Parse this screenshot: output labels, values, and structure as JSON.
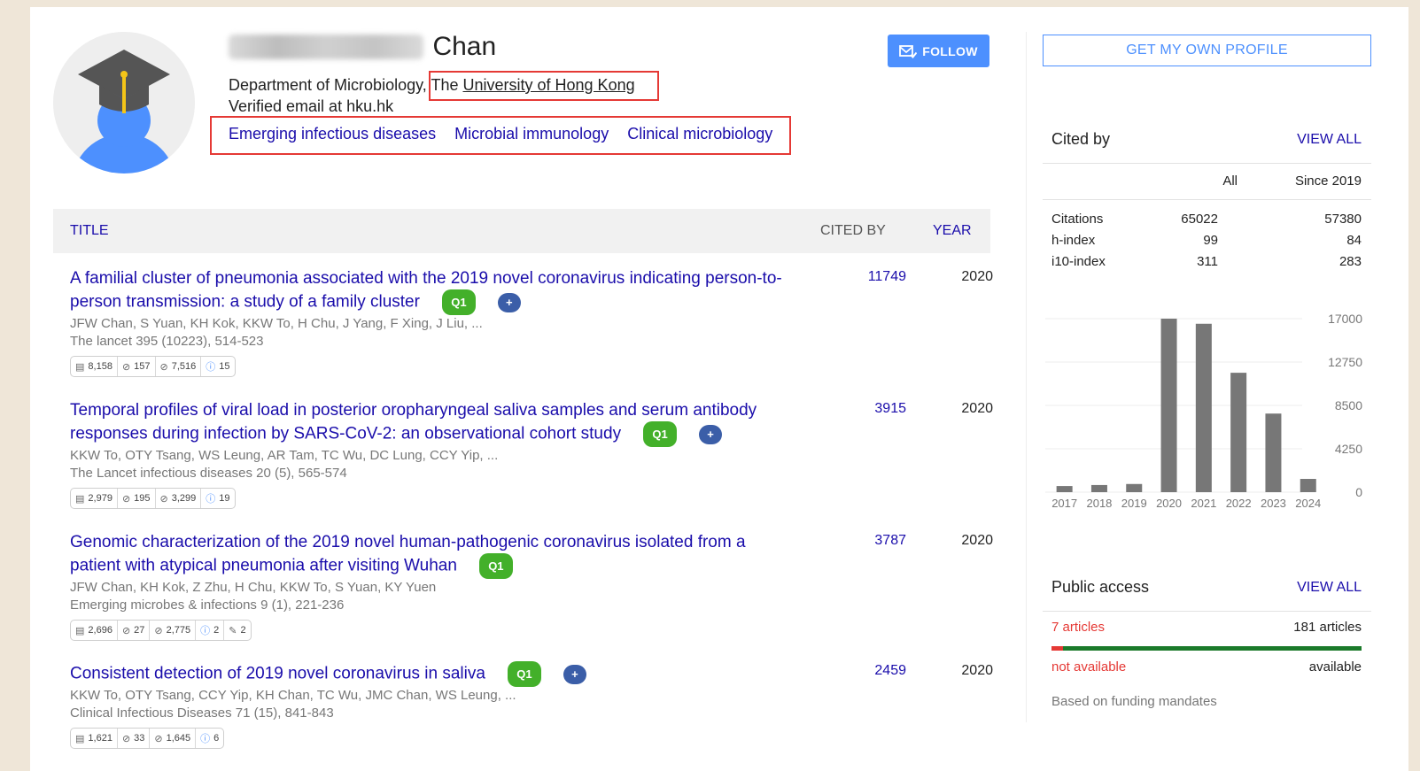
{
  "profile": {
    "name_visible": "Chan",
    "affiliation_prefix": "Department of Microbiology,",
    "affiliation_the": "The",
    "affiliation_link": "University of Hong Kong",
    "email": "Verified email at hku.hk",
    "interests": [
      "Emerging infectious diseases",
      "Microbial immunology",
      "Clinical microbiology"
    ],
    "follow_label": "FOLLOW"
  },
  "table": {
    "col_title": "TITLE",
    "col_cited": "CITED BY",
    "col_year": "YEAR"
  },
  "articles": [
    {
      "title": "A familial cluster of pneumonia associated with the 2019 novel coronavirus indicating person-to-person transmission: a study of a family cluster",
      "authors": "JFW Chan, S Yuan, KH Kok, KKW To, H Chu, J Yang, F Xing, J Liu, ...",
      "venue": "The lancet 395 (10223), 514-523",
      "cited": "11749",
      "year": "2020",
      "badge": "Q1",
      "badge_plus": "+",
      "metrics": [
        "8,158",
        "157",
        "7,516",
        "15"
      ]
    },
    {
      "title": "Temporal profiles of viral load in posterior oropharyngeal saliva samples and serum antibody responses during infection by SARS-CoV-2: an observational cohort study",
      "authors": "KKW To, OTY Tsang, WS Leung, AR Tam, TC Wu, DC Lung, CCY Yip, ...",
      "venue": "The Lancet infectious diseases 20 (5), 565-574",
      "cited": "3915",
      "year": "2020",
      "badge": "Q1",
      "badge_plus": "+",
      "metrics": [
        "2,979",
        "195",
        "3,299",
        "19"
      ]
    },
    {
      "title": "Genomic characterization of the 2019 novel human-pathogenic coronavirus isolated from a patient with atypical pneumonia after visiting Wuhan",
      "authors": "JFW Chan, KH Kok, Z Zhu, H Chu, KKW To, S Yuan, KY Yuen",
      "venue": "Emerging microbes & infections 9 (1), 221-236",
      "cited": "3787",
      "year": "2020",
      "badge": "Q1",
      "metrics": [
        "2,696",
        "27",
        "2,775",
        "2",
        "2"
      ]
    },
    {
      "title": "Consistent detection of 2019 novel coronavirus in saliva",
      "authors": "KKW To, OTY Tsang, CCY Yip, KH Chan, TC Wu, JMC Chan, WS Leung, ...",
      "venue": "Clinical Infectious Diseases 71 (15), 841-843",
      "cited": "2459",
      "year": "2020",
      "badge": "Q1",
      "badge_plus": "+",
      "metrics": [
        "1,621",
        "33",
        "1,645",
        "6"
      ]
    }
  ],
  "sidebar": {
    "get_profile": "GET MY OWN PROFILE",
    "cited_by_title": "Cited by",
    "view_all": "VIEW ALL",
    "col_all": "All",
    "col_since": "Since 2019",
    "stats": [
      {
        "label": "Citations",
        "all": "65022",
        "since": "57380"
      },
      {
        "label": "h-index",
        "all": "99",
        "since": "84"
      },
      {
        "label": "i10-index",
        "all": "311",
        "since": "283"
      }
    ],
    "public_access_title": "Public access",
    "public_view_all": "VIEW ALL",
    "not_available_count": "7 articles",
    "available_count": "181 articles",
    "not_available_label": "not available",
    "available_label": "available",
    "funding_note": "Based on funding mandates",
    "access_colors": {
      "not_available": "#e53935",
      "available": "#1b7a2a"
    }
  },
  "chart_data": {
    "type": "bar",
    "categories": [
      "2017",
      "2018",
      "2019",
      "2020",
      "2021",
      "2022",
      "2023",
      "2024"
    ],
    "values": [
      600,
      700,
      800,
      17000,
      16500,
      11700,
      7700,
      1300
    ],
    "yticks": [
      "17000",
      "12750",
      "8500",
      "4250",
      "0"
    ],
    "ylim": [
      0,
      17000
    ],
    "grid": true,
    "bar_color": "#777777"
  }
}
